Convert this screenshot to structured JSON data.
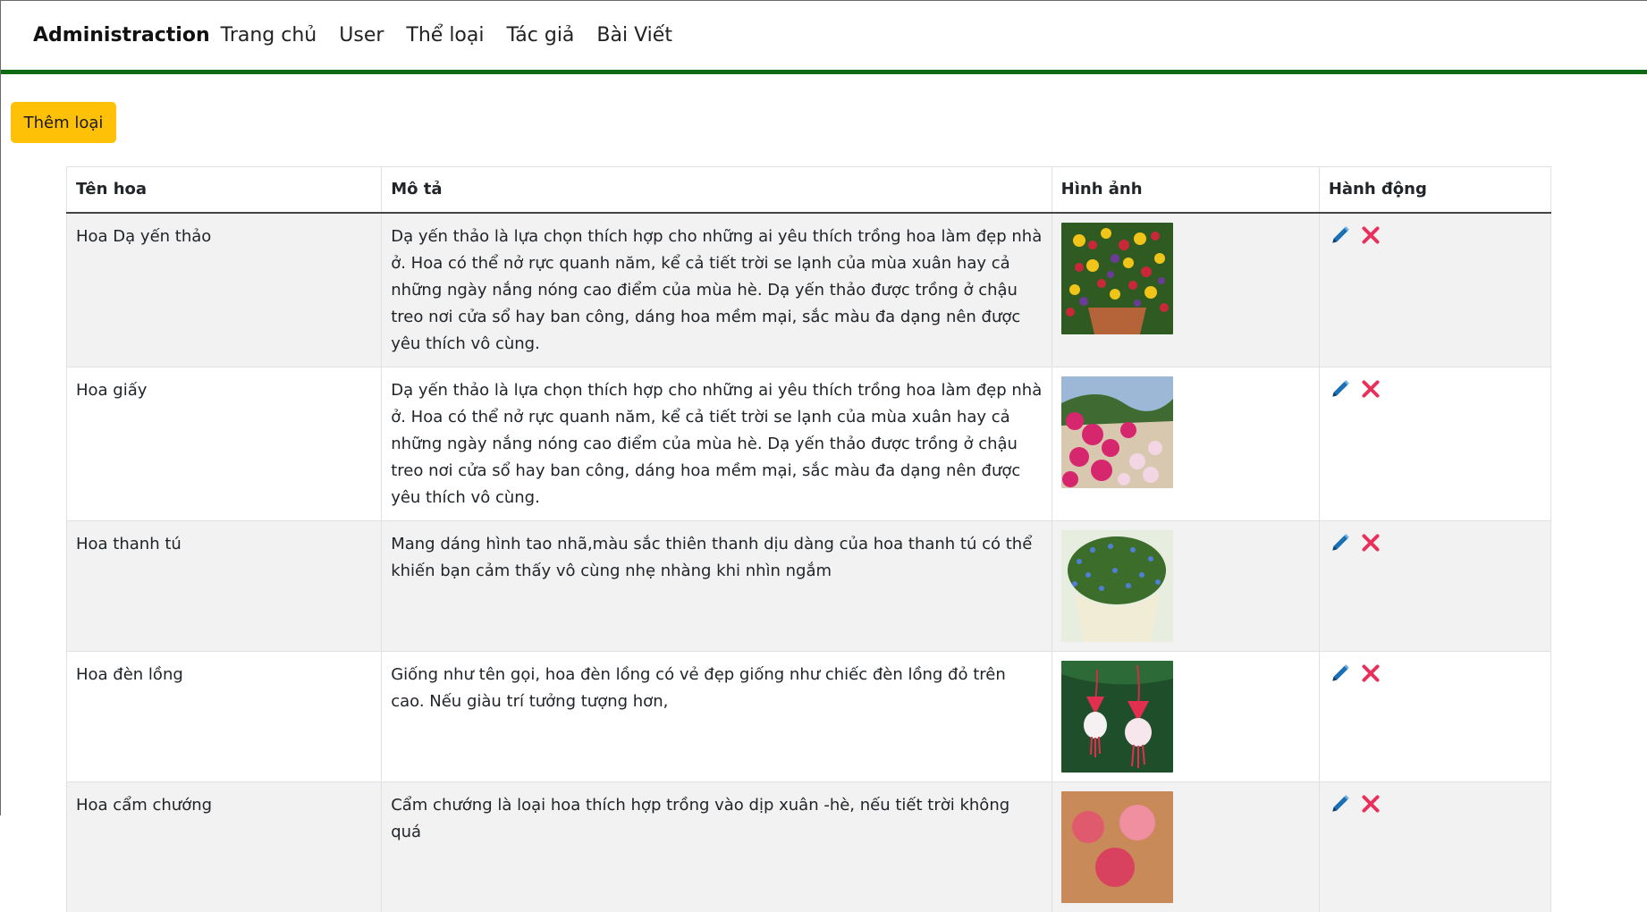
{
  "navbar": {
    "brand": "Administraction",
    "links": [
      "Trang chủ",
      "User",
      "Thể loại",
      "Tác giả",
      "Bài Viết"
    ]
  },
  "toolbar": {
    "add_label": "Thêm loại"
  },
  "table": {
    "headers": [
      "Tên hoa",
      "Mô tả",
      "Hình ảnh",
      "Hành động"
    ],
    "rows": [
      {
        "name": "Hoa Dạ yến thảo",
        "description": "Dạ yến thảo là lựa chọn thích hợp cho những ai yêu thích trồng hoa làm đẹp nhà ở. Hoa có thể nở rực quanh năm, kể cả tiết trời se lạnh của mùa xuân hay cả những ngày nắng nóng cao điểm của mùa hè. Dạ yến thảo được trồng ở chậu treo nơi cửa sổ hay ban công, dáng hoa mềm mại, sắc màu đa dạng nên được yêu thích vô cùng."
      },
      {
        "name": "Hoa giấy",
        "description": "Dạ yến thảo là lựa chọn thích hợp cho những ai yêu thích trồng hoa làm đẹp nhà ở. Hoa có thể nở rực quanh năm, kể cả tiết trời se lạnh của mùa xuân hay cả những ngày nắng nóng cao điểm của mùa hè. Dạ yến thảo được trồng ở chậu treo nơi cửa sổ hay ban công, dáng hoa mềm mại, sắc màu đa dạng nên được yêu thích vô cùng."
      },
      {
        "name": "Hoa thanh tú",
        "description": "Mang dáng hình tao nhã,màu sắc thiên thanh dịu dàng của hoa thanh tú có thể khiến bạn cảm thấy vô cùng nhẹ nhàng khi nhìn ngắm"
      },
      {
        "name": "Hoa đèn lồng",
        "description": "Giống như tên gọi, hoa đèn lồng có vẻ đẹp giống như chiếc đèn lồng đỏ trên cao. Nếu giàu trí tưởng tượng hơn,"
      },
      {
        "name": "Hoa cẩm chướng",
        "description": "Cẩm chướng là loại hoa thích hợp trồng vào dịp xuân -hè, nếu tiết trời không quá"
      }
    ]
  },
  "icons": {
    "edit": "pencil-icon",
    "delete": "close-icon"
  },
  "colors": {
    "nav_border": "#0e6b12",
    "add_button": "#ffc107",
    "edit_icon": "#1b6fb5",
    "delete_icon": "#e8305b",
    "stripe": "#f2f2f2"
  }
}
